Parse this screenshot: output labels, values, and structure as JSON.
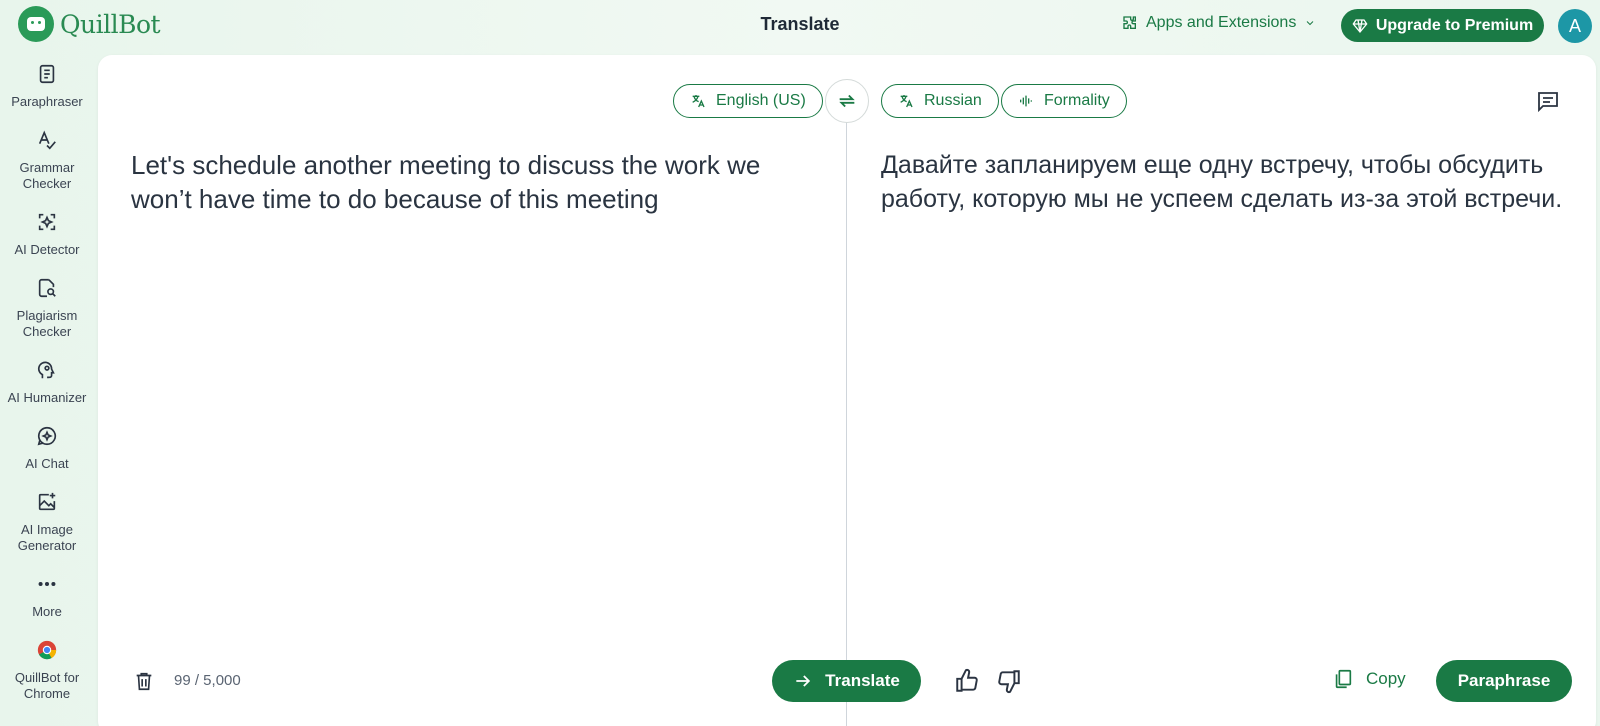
{
  "header": {
    "logo_text": "QuillBot",
    "title": "Translate",
    "apps_extensions": "Apps and Extensions",
    "upgrade": "Upgrade to Premium",
    "avatar_initial": "A"
  },
  "sidebar": {
    "items": [
      {
        "label": "Paraphraser",
        "icon": "paraphraser-icon"
      },
      {
        "label": "Grammar Checker",
        "icon": "grammar-checker-icon"
      },
      {
        "label": "AI Detector",
        "icon": "ai-detector-icon"
      },
      {
        "label": "Plagiarism Checker",
        "icon": "plagiarism-checker-icon"
      },
      {
        "label": "AI Humanizer",
        "icon": "ai-humanizer-icon"
      },
      {
        "label": "AI Chat",
        "icon": "ai-chat-icon"
      },
      {
        "label": "AI Image Generator",
        "icon": "ai-image-generator-icon"
      },
      {
        "label": "More",
        "icon": "more-icon"
      },
      {
        "label": "QuillBot for Chrome",
        "icon": "chrome-icon"
      }
    ]
  },
  "translator": {
    "source_language": "English (US)",
    "target_language": "Russian",
    "formality_label": "Formality",
    "source_text": "Let's schedule another meeting to discuss the work we won’t have time to do because of this meeting",
    "target_text": "Давайте запланируем еще одну встречу, чтобы обсудить работу, которую мы не успеем сделать из-за этой встречи.",
    "char_count": "99 / 5,000",
    "translate_button": "Translate",
    "copy_button": "Copy",
    "paraphrase_button": "Paraphrase"
  },
  "colors": {
    "brand_green": "#1a7a45",
    "avatar_teal": "#1d97a6"
  }
}
